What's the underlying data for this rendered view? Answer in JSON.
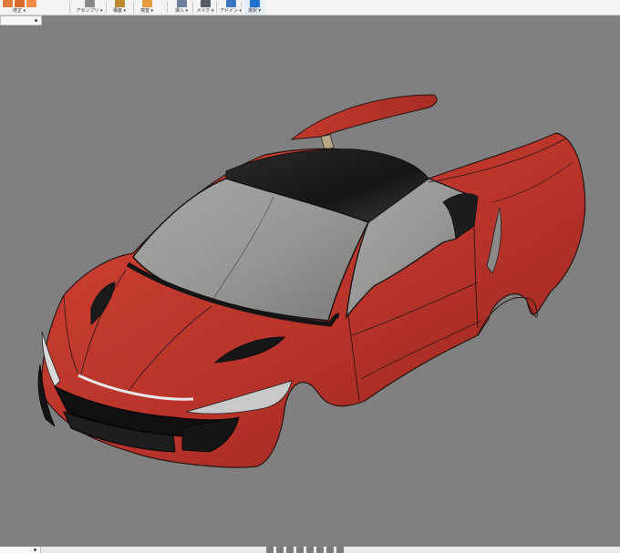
{
  "toolbar": {
    "groups": [
      {
        "label": "修正",
        "dropdown": true,
        "colors": [
          "#e07a3c",
          "#d86a2e",
          "#ee8b45"
        ]
      },
      {
        "label": "アセンブリ",
        "dropdown": true,
        "colors": [
          "#8a8a8a"
        ]
      },
      {
        "label": "構築",
        "dropdown": true,
        "colors": [
          "#b9892f"
        ]
      },
      {
        "label": "検査",
        "dropdown": true,
        "colors": [
          "#e59a3c"
        ]
      },
      {
        "label": "挿入",
        "dropdown": true,
        "colors": [
          "#6b7f99"
        ]
      },
      {
        "label": "メイク",
        "dropdown": true,
        "colors": [
          "#555c66"
        ]
      },
      {
        "label": "アドイン",
        "dropdown": true,
        "colors": [
          "#3c78c2"
        ]
      },
      {
        "label": "選択",
        "dropdown": true,
        "colors": [
          "#1f6fd1"
        ],
        "active": true
      }
    ]
  },
  "colors": {
    "canvas": "#808080",
    "body_red": "#c0392b",
    "glass": "#9d9b97",
    "roof": "#1d1d1d"
  },
  "icons": {
    "dropdown": "chevron-down-icon",
    "panel_dot": "bullet-icon"
  }
}
